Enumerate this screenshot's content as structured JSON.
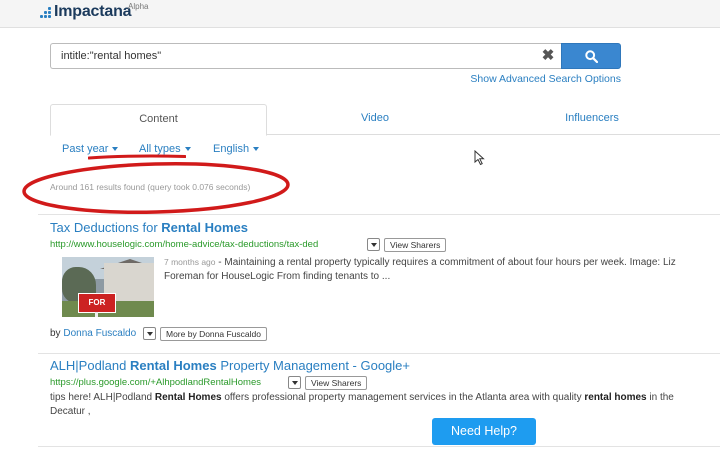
{
  "app": {
    "name": "Impactana",
    "badge": "Alpha"
  },
  "search": {
    "query": "intitle:\"rental homes\"",
    "clear_symbol": "✖",
    "advanced_link": "Show Advanced Search Options"
  },
  "tabs": [
    {
      "label": "Content",
      "active": true
    },
    {
      "label": "Video",
      "active": false
    },
    {
      "label": "Influencers",
      "active": false
    }
  ],
  "filters": {
    "time": "Past year",
    "type": "All types",
    "language": "English"
  },
  "results_summary": "Around 161 results found (query took 0.076 seconds)",
  "results": [
    {
      "title_prefix": "Tax Deductions for ",
      "title_bold": "Rental Homes",
      "url": "http://www.houselogic.com/home-advice/tax-deductions/tax-ded",
      "sharers_label": "View Sharers",
      "age": "7 months ago",
      "snippet_sep": " - ",
      "snippet": "Maintaining a rental property typically requires a commitment of about four hours per week. Image: Liz Foreman for HouseLogic From finding tenants to ...",
      "thumbnail_text": "FOR RENT",
      "by_label": "by ",
      "author": "Donna Fuscaldo",
      "more_label": "More by Donna Fuscaldo"
    },
    {
      "title_prefix": "ALH|Podland ",
      "title_bold": "Rental Homes",
      "title_suffix": " Property Management - Google+",
      "url": "https://plus.google.com/+AlhpodlandRentalHomes",
      "sharers_label": "View Sharers",
      "snippet_a": "tips here! ALH|Podland ",
      "snippet_bold_1": "Rental Homes",
      "snippet_b": "  offers professional  property management  services in the Atlanta area with quality  ",
      "snippet_bold_2": "rental homes",
      "snippet_c": "  in the  Decatur ,"
    }
  ],
  "help_button": "Need Help?",
  "colors": {
    "accent": "#2a7fc1",
    "url_green": "#2a9a2a",
    "annotation_red": "#d11a1a",
    "help_blue": "#1e9cf0"
  }
}
